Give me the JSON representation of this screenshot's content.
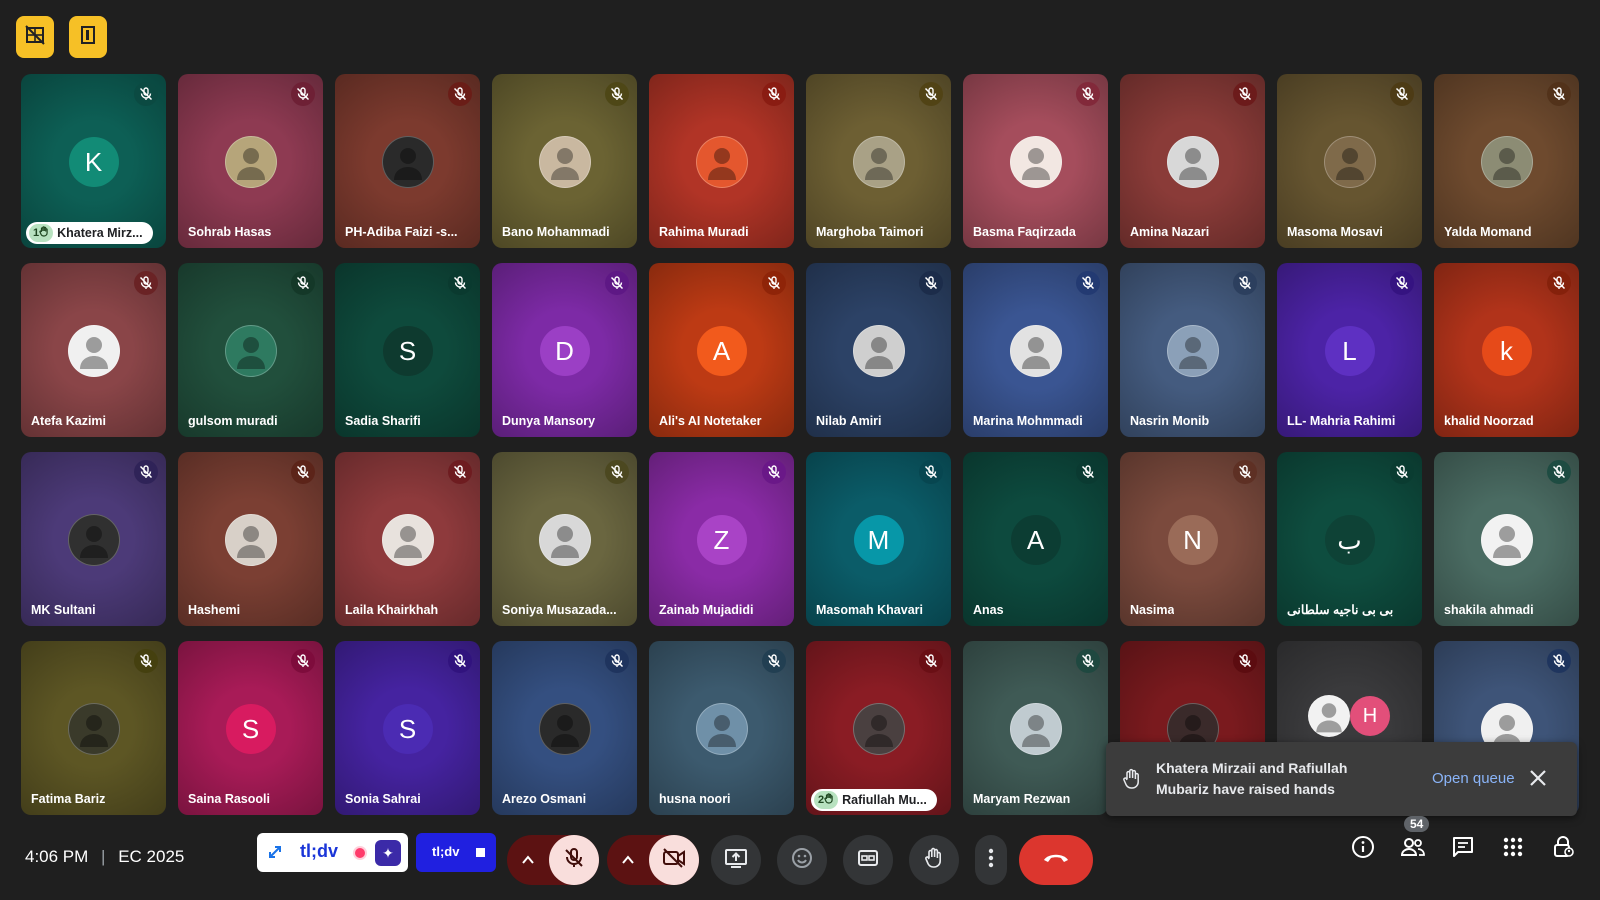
{
  "top_buttons": [
    {
      "icon": "no-video-grid-icon"
    },
    {
      "icon": "door-exit-icon"
    }
  ],
  "tiles": [
    {
      "name": "Khatera Mirz...",
      "kind": "letter",
      "letter": "K",
      "bg": "#0d5f55",
      "circle": "#128b76",
      "muted_color": "#0b4a42",
      "hand_count": "1"
    },
    {
      "name": "Sohrab Hasas",
      "kind": "photo",
      "bg": "#8e3a52",
      "circle": "#b6a57a",
      "muted_color": "#6e2035"
    },
    {
      "name": "PH-Adiba Faizi -s...",
      "kind": "photo",
      "bg": "#7c3a2e",
      "circle": "#2a2a2a",
      "muted_color": "#6a1d17"
    },
    {
      "name": "Bano Mohammadi",
      "kind": "photo",
      "bg": "#6b6333",
      "circle": "#c9b8a0",
      "muted_color": "#4e4716"
    },
    {
      "name": "Rahima Muradi",
      "kind": "photo",
      "bg": "#b13426",
      "circle": "#e4572e",
      "muted_color": "#8a1c12"
    },
    {
      "name": "Marghoba Taimori",
      "kind": "photo",
      "bg": "#6d5f33",
      "circle": "#a9a186",
      "muted_color": "#514315"
    },
    {
      "name": "Basma Faqirzada",
      "kind": "photo",
      "bg": "#a54d5c",
      "circle": "#f2e7e2",
      "muted_color": "#82293a"
    },
    {
      "name": "Amina Nazari",
      "kind": "photo",
      "bg": "#8a3b38",
      "circle": "#d8d8d8",
      "muted_color": "#6c1b1b"
    },
    {
      "name": "Masoma Mosavi",
      "kind": "photo",
      "bg": "#665530",
      "circle": "#7f6a4a",
      "muted_color": "#4d3b15"
    },
    {
      "name": "Yalda Momand",
      "kind": "photo",
      "bg": "#6e4a2e",
      "circle": "#8c8c74",
      "muted_color": "#52321a"
    },
    {
      "name": "Atefa Kazimi",
      "kind": "photo",
      "bg": "#8a4548",
      "circle": "#f0f0f0",
      "muted_color": "#6a2325"
    },
    {
      "name": "gulsom muradi",
      "kind": "photo",
      "bg": "#214f3c",
      "circle": "#2e7a60",
      "muted_color": "#143828"
    },
    {
      "name": "Sadia Sharifi",
      "kind": "letter",
      "letter": "S",
      "bg": "#0e4a3c",
      "circle": "#0e3a2f",
      "muted_color": "#0a3a2f"
    },
    {
      "name": "Dunya Mansory",
      "kind": "letter",
      "letter": "D",
      "bg": "#7d2aa6",
      "circle": "#9b3fc5",
      "muted_color": "#5e1885"
    },
    {
      "name": "Ali's AI Notetaker",
      "kind": "letter",
      "letter": "A",
      "bg": "#bd3a14",
      "circle": "#f25a1c",
      "muted_color": "#8f2408"
    },
    {
      "name": "Nilab Amiri",
      "kind": "photo",
      "bg": "#2c4266",
      "circle": "#cfcfcf",
      "muted_color": "#1c2c4a"
    },
    {
      "name": "Marina Mohmmadi",
      "kind": "photo",
      "bg": "#3a5592",
      "circle": "#e2e2e2",
      "muted_color": "#233a72"
    },
    {
      "name": "Nasrin Monib",
      "kind": "photo",
      "bg": "#445b7f",
      "circle": "#8ba0b8",
      "muted_color": "#2c3f5e"
    },
    {
      "name": "LL- Mahria Rahimi",
      "kind": "letter",
      "letter": "L",
      "bg": "#4c23a6",
      "circle": "#5e30c2",
      "muted_color": "#351381"
    },
    {
      "name": "khalid Noorzad",
      "kind": "letter",
      "letter": "k",
      "bg": "#b1331a",
      "circle": "#e64a19",
      "muted_color": "#85210b"
    },
    {
      "name": "MK Sultani",
      "kind": "photo",
      "bg": "#4c3a78",
      "circle": "#303030",
      "muted_color": "#2f2358"
    },
    {
      "name": "Hashemi",
      "kind": "photo",
      "bg": "#7b3f33",
      "circle": "#d8d0c8",
      "muted_color": "#5c2419"
    },
    {
      "name": "Laila Khairkhah",
      "kind": "photo",
      "bg": "#8e3a3c",
      "circle": "#e8e2dd",
      "muted_color": "#6e1c20"
    },
    {
      "name": "Soniya Musazada...",
      "kind": "photo",
      "bg": "#6a6640",
      "circle": "#d8d8d8",
      "muted_color": "#4c4820"
    },
    {
      "name": "Zainab Mujadidi",
      "kind": "letter",
      "letter": "Z",
      "bg": "#8a2ba6",
      "circle": "#a943c6",
      "muted_color": "#6a1888"
    },
    {
      "name": "Masomah Khavari",
      "kind": "letter",
      "letter": "M",
      "bg": "#0b5c68",
      "circle": "#0797a8",
      "muted_color": "#074650"
    },
    {
      "name": "Anas",
      "kind": "letter",
      "letter": "A",
      "bg": "#0d4a3e",
      "circle": "#0c3d33",
      "muted_color": "#0a3a31"
    },
    {
      "name": "Nasima",
      "kind": "letter",
      "letter": "N",
      "bg": "#7b4a3d",
      "circle": "#9a6b58",
      "muted_color": "#5e3024"
    },
    {
      "name": "بی بی ناجیه سلطانی",
      "kind": "letter",
      "letter": "ب",
      "bg": "#0e4d3f",
      "circle": "#0e4236",
      "muted_color": "#0a3c31"
    },
    {
      "name": "shakila ahmadi",
      "kind": "photo",
      "bg": "#4a6b62",
      "circle": "#f2f2f2",
      "muted_color": "#1e4c42"
    },
    {
      "name": "Fatima Bariz",
      "kind": "photo",
      "bg": "#5d5624",
      "circle": "#3a3a2a",
      "muted_color": "#45400f"
    },
    {
      "name": "Saina Rasooli",
      "kind": "letter",
      "letter": "S",
      "bg": "#a81b57",
      "circle": "#d81b60",
      "muted_color": "#7e0c3c"
    },
    {
      "name": "Sonia Sahrai",
      "kind": "letter",
      "letter": "S",
      "bg": "#4523a0",
      "circle": "#4b2bb3",
      "muted_color": "#31137e"
    },
    {
      "name": "Arezo Osmani",
      "kind": "photo",
      "bg": "#344f80",
      "circle": "#2a2a2a",
      "muted_color": "#1f345e"
    },
    {
      "name": "husna noori",
      "kind": "photo",
      "bg": "#3c5a6e",
      "circle": "#6f90a8",
      "muted_color": "#223f52"
    },
    {
      "name": "Rafiullah Mu...",
      "kind": "photo",
      "bg": "#8a1c24",
      "circle": "#4a4040",
      "muted_color": "#6a0f15",
      "hand_count": "2"
    },
    {
      "name": "Maryam Rezwan",
      "kind": "photo",
      "bg": "#3f5a55",
      "circle": "#c0cbd0",
      "muted_color": "#1f4840"
    },
    {
      "name": "",
      "kind": "photo",
      "bg": "#7a1a1e",
      "circle": "#3a2a2a",
      "muted_color": "#5c0c10"
    },
    {
      "name": "",
      "kind": "pair",
      "bg": "#3a3a3c",
      "circle": "#e24f7a",
      "letter": "H",
      "muted_color": ""
    },
    {
      "name": "",
      "kind": "photo",
      "bg": "#3e5478",
      "circle": "#f0f0f0",
      "muted_color": "#1f355e"
    }
  ],
  "toast": {
    "message": "Khatera Mirzaii and Rafiullah Mubariz have raised hands",
    "open_label": "Open queue"
  },
  "bottom_bar": {
    "time": "4:06 PM",
    "meeting_code": "EC 2025",
    "tldv_label": "tl;dv",
    "tldv_small_label": "tl;dv",
    "participant_count": "54"
  }
}
